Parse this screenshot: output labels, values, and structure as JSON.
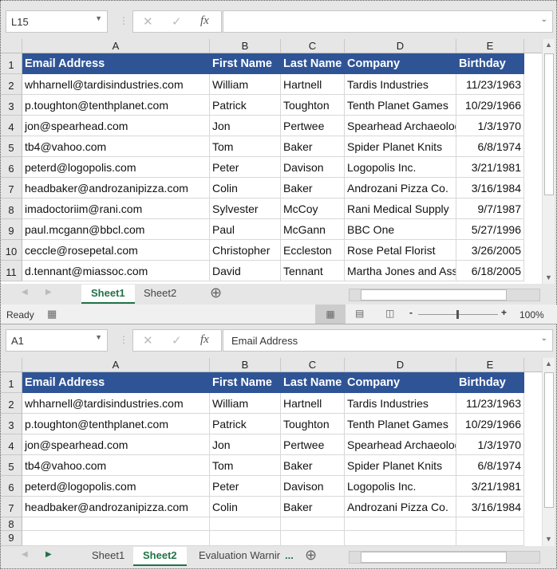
{
  "columns": [
    "A",
    "B",
    "C",
    "D",
    "E"
  ],
  "top": {
    "name_box": "L15",
    "formula": "",
    "rows": [
      [
        "Email Address",
        "First Name",
        "Last Name",
        "Company",
        "Birthday"
      ],
      [
        "whharnell@tardisindustries.com",
        "William",
        "Hartnell",
        "Tardis Industries",
        "11/23/1963"
      ],
      [
        "p.toughton@tenthplanet.com",
        "Patrick",
        "Toughton",
        "Tenth Planet Games",
        "10/29/1966"
      ],
      [
        "jon@spearhead.com",
        "Jon",
        "Pertwee",
        "Spearhead Archaeology",
        "1/3/1970"
      ],
      [
        "tb4@vahoo.com",
        "Tom",
        "Baker",
        "Spider Planet Knits",
        "6/8/1974"
      ],
      [
        "peterd@logopolis.com",
        "Peter",
        "Davison",
        "Logopolis Inc.",
        "3/21/1981"
      ],
      [
        "headbaker@androzanipizza.com",
        "Colin",
        "Baker",
        "Androzani Pizza Co.",
        "3/16/1984"
      ],
      [
        "imadoctoriim@rani.com",
        "Sylvester",
        "McCoy",
        "Rani Medical Supply",
        "9/7/1987"
      ],
      [
        "paul.mcgann@bbcl.com",
        "Paul",
        "McGann",
        "BBC One",
        "5/27/1996"
      ],
      [
        "ceccle@rosepetal.com",
        "Christopher",
        "Eccleston",
        "Rose Petal Florist",
        "3/26/2005"
      ],
      [
        "d.tennant@miassoc.com",
        "David",
        "Tennant",
        "Martha Jones and Associates",
        "6/18/2005"
      ]
    ],
    "row_numbers": [
      "1",
      "2",
      "3",
      "4",
      "5",
      "6",
      "7",
      "8",
      "9",
      "10",
      "11"
    ],
    "tabs": [
      "Sheet1",
      "Sheet2"
    ],
    "active_tab": 0
  },
  "status": {
    "ready": "Ready",
    "zoom": "100%"
  },
  "bottom": {
    "name_box": "A1",
    "formula": "Email Address",
    "rows": [
      [
        "Email Address",
        "First Name",
        "Last Name",
        "Company",
        "Birthday"
      ],
      [
        "whharnell@tardisindustries.com",
        "William",
        "Hartnell",
        "Tardis Industries",
        "11/23/1963"
      ],
      [
        "p.toughton@tenthplanet.com",
        "Patrick",
        "Toughton",
        "Tenth Planet Games",
        "10/29/1966"
      ],
      [
        "jon@spearhead.com",
        "Jon",
        "Pertwee",
        "Spearhead Archaeology",
        "1/3/1970"
      ],
      [
        "tb4@vahoo.com",
        "Tom",
        "Baker",
        "Spider Planet Knits",
        "6/8/1974"
      ],
      [
        "peterd@logopolis.com",
        "Peter",
        "Davison",
        "Logopolis Inc.",
        "3/21/1981"
      ],
      [
        "headbaker@androzanipizza.com",
        "Colin",
        "Baker",
        "Androzani Pizza Co.",
        "3/16/1984"
      ],
      [
        "",
        "",
        "",
        "",
        ""
      ],
      [
        "",
        "",
        "",
        "",
        ""
      ]
    ],
    "row_numbers": [
      "1",
      "2",
      "3",
      "4",
      "5",
      "6",
      "7",
      "8",
      "9"
    ],
    "tabs": [
      "Sheet1",
      "Sheet2",
      "Evaluation Warnir"
    ],
    "more": "...",
    "active_tab": 1
  },
  "icons": {
    "cancel": "✕",
    "enter": "✓",
    "fx": "fx",
    "add_sheet": "⊕"
  }
}
